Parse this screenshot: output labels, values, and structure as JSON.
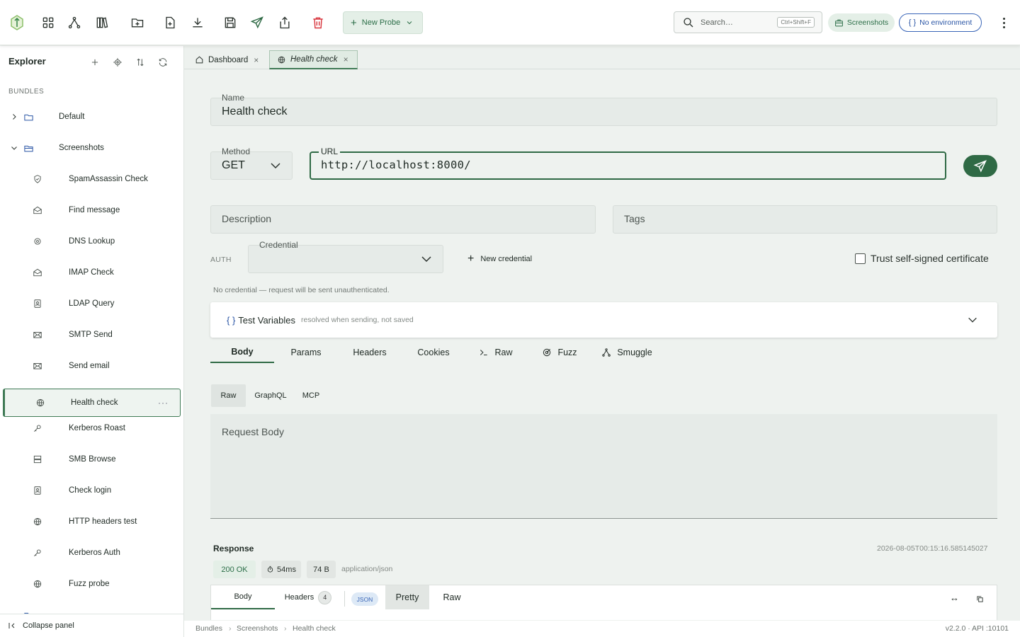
{
  "toolbar": {
    "new_probe_label": "New Probe",
    "search_placeholder": "Search…",
    "search_shortcut": "Ctrl+Shift+F",
    "workspace_label": "Screenshots",
    "environment_label": "No environment"
  },
  "sidebar": {
    "title": "Explorer",
    "section_label": "BUNDLES",
    "bundles": [
      {
        "label": "Default",
        "expanded": false
      },
      {
        "label": "Screenshots",
        "expanded": true
      }
    ],
    "items": [
      {
        "label": "SpamAssassin Check",
        "icon": "shield-icon"
      },
      {
        "label": "Find message",
        "icon": "envelope-open-icon"
      },
      {
        "label": "DNS Lookup",
        "icon": "target-icon"
      },
      {
        "label": "IMAP Check",
        "icon": "envelope-open-icon"
      },
      {
        "label": "LDAP Query",
        "icon": "contact-book-icon"
      },
      {
        "label": "SMTP Send",
        "icon": "envelope-icon"
      },
      {
        "label": "Send email",
        "icon": "envelope-icon"
      },
      {
        "label": "Health check",
        "icon": "globe-icon",
        "active": true
      },
      {
        "label": "Kerberos Roast",
        "icon": "key-icon"
      },
      {
        "label": "SMB Browse",
        "icon": "server-icon"
      },
      {
        "label": "Check login",
        "icon": "contact-book-icon"
      },
      {
        "label": "HTTP headers test",
        "icon": "globe-icon"
      },
      {
        "label": "Kerberos Auth",
        "icon": "key-icon"
      },
      {
        "label": "Fuzz probe",
        "icon": "globe-icon"
      }
    ],
    "collapse_label": "Collapse panel"
  },
  "tabs": [
    {
      "label": "Dashboard",
      "icon": "home-icon"
    },
    {
      "label": "Health check",
      "icon": "globe-icon",
      "active": true
    }
  ],
  "form": {
    "name_label": "Name",
    "name_value": "Health check",
    "method_label": "Method",
    "method_value": "GET",
    "url_label": "URL",
    "url_value": "http://localhost:8000/",
    "description_placeholder": "Description",
    "tags_placeholder": "Tags",
    "auth_label": "AUTH",
    "credential_label": "Credential",
    "new_credential_label": "New credential",
    "trust_label": "Trust self-signed certificate",
    "no_credential_note": "No credential — request will be sent unauthenticated."
  },
  "test_variables": {
    "title": "Test Variables",
    "subtitle": "resolved when sending, not saved"
  },
  "request_tabs": [
    "Body",
    "Params",
    "Headers",
    "Cookies",
    "Raw",
    "Fuzz",
    "Smuggle"
  ],
  "body_modes": [
    "Raw",
    "GraphQL",
    "MCP"
  ],
  "request_body_placeholder": "Request Body",
  "response": {
    "title": "Response",
    "timestamp": "2026-08-05T00:15:16.585145027",
    "status": "200 OK",
    "time": "54ms",
    "size": "74 B",
    "content_type": "application/json",
    "tabs": {
      "body": "Body",
      "headers": "Headers",
      "headers_count": "4",
      "json": "JSON",
      "pretty": "Pretty",
      "raw": "Raw"
    }
  },
  "statusbar": {
    "crumbs": [
      "Bundles",
      "Screenshots",
      "Health check"
    ],
    "version": "v2.2.0 · API :10101"
  },
  "colors": {
    "accent": "#2f6a45",
    "accent_light": "#e4efe7",
    "env_blue": "#2a55a5",
    "danger": "#d9363e"
  }
}
